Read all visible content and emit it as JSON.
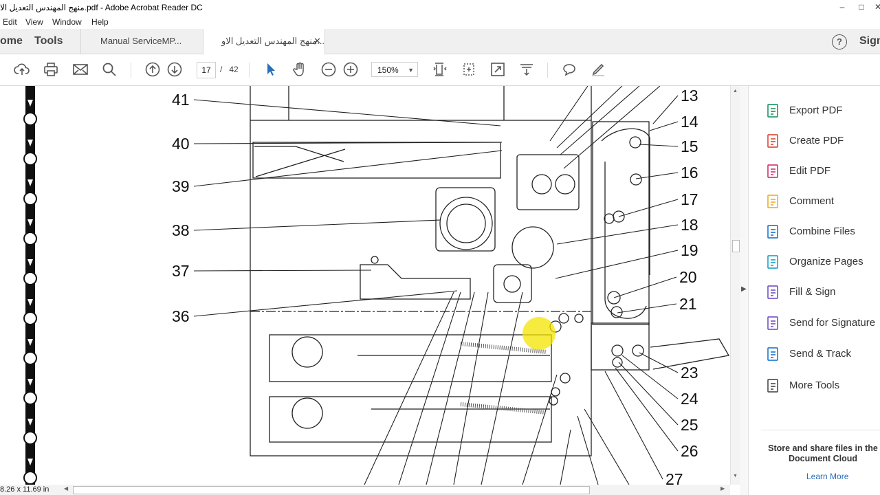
{
  "window": {
    "title": "منهج المهندس التعديل الا.pdf - Adobe Acrobat Reader DC"
  },
  "menu": [
    "Edit",
    "View",
    "Window",
    "Help"
  ],
  "nav": {
    "home": "ome",
    "tools": "Tools",
    "sign": "Sign"
  },
  "doc_tabs": [
    {
      "label": "Manual ServiceMP..."
    },
    {
      "label": "منهج المهندس التعديل الاو..."
    }
  ],
  "toolbar": {
    "page_current": "17",
    "page_sep": "/",
    "page_total": "42",
    "zoom": "150%"
  },
  "diagram": {
    "left_labels": [
      "41",
      "40",
      "39",
      "38",
      "37",
      "36"
    ],
    "right_labels": [
      "13",
      "14",
      "15",
      "16",
      "17",
      "18",
      "19",
      "20",
      "21",
      "23",
      "24",
      "25",
      "26",
      "27"
    ]
  },
  "right_panel": {
    "tools": [
      {
        "label": "Export PDF",
        "icon": "export-pdf-icon",
        "color": "#2f9a6e"
      },
      {
        "label": "Create PDF",
        "icon": "create-pdf-icon",
        "color": "#e0523f"
      },
      {
        "label": "Edit PDF",
        "icon": "edit-pdf-icon",
        "color": "#d23f7a"
      },
      {
        "label": "Comment",
        "icon": "comment-icon",
        "color": "#f2b233"
      },
      {
        "label": "Combine Files",
        "icon": "combine-files-icon",
        "color": "#2b7fd1"
      },
      {
        "label": "Organize Pages",
        "icon": "organize-pages-icon",
        "color": "#2aa6c9"
      },
      {
        "label": "Fill & Sign",
        "icon": "fill-sign-icon",
        "color": "#7a5dc7"
      },
      {
        "label": "Send for Signature",
        "icon": "send-signature-icon",
        "color": "#7a5dc7"
      },
      {
        "label": "Send & Track",
        "icon": "send-track-icon",
        "color": "#2b7fd1"
      },
      {
        "label": "More Tools",
        "icon": "more-tools-icon",
        "color": "#555555"
      }
    ],
    "store_text": "Store and share files in the Document Cloud",
    "learn_more": "Learn More"
  },
  "status": {
    "page_size": "8.26 x 11.69 in"
  }
}
